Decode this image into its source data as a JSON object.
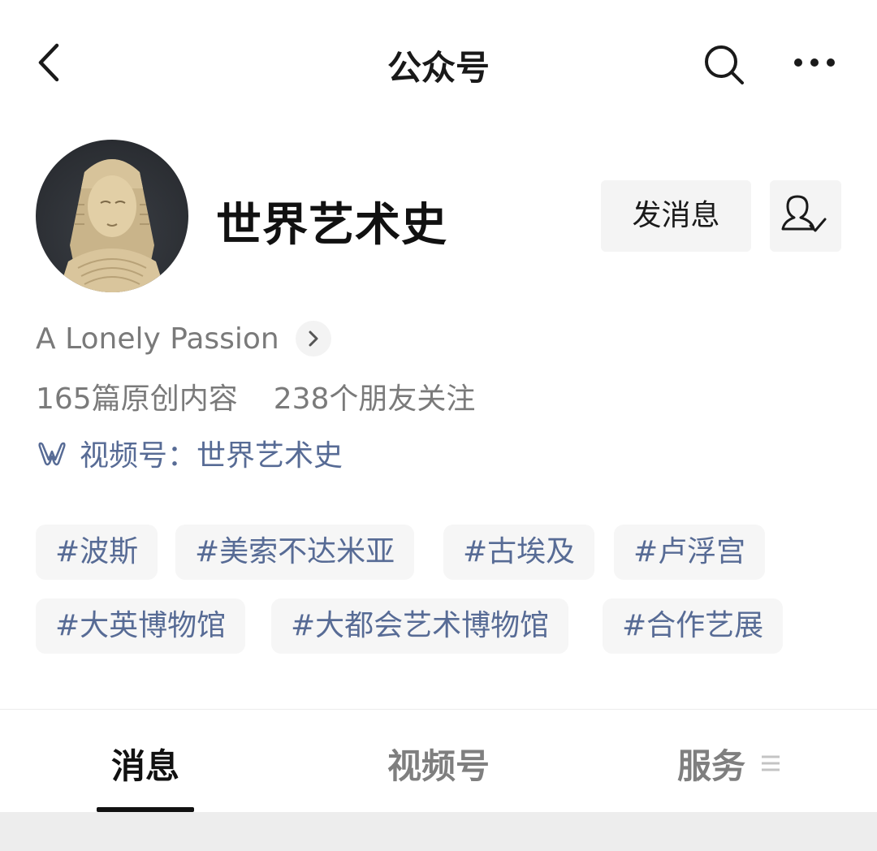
{
  "header": {
    "title": "公众号",
    "back_icon": "chevron-left-icon",
    "search_icon": "search-icon",
    "more_icon": "more-horizontal-icon"
  },
  "profile": {
    "name": "世界艺术史",
    "message_button": "发消息",
    "follow_icon": "user-check-icon",
    "intro": "A Lonely Passion",
    "stats": {
      "articles": "165篇原创内容",
      "friends": "238个朋友关注"
    },
    "channel": {
      "icon": "video-channel-icon",
      "text": "视频号：世界艺术史"
    }
  },
  "tags": [
    "#波斯",
    "#美索不达米亚",
    "#古埃及",
    "#卢浮宫",
    "#大英博物馆",
    "#大都会艺术博物馆",
    "#合作艺展"
  ],
  "tabs": [
    {
      "label": "消息",
      "active": true
    },
    {
      "label": "视频号",
      "active": false
    },
    {
      "label": "服务",
      "active": false,
      "icon": "menu-icon"
    }
  ],
  "colors": {
    "link": "#576b95",
    "gray_text": "#7a7a7a",
    "button_bg": "#f4f4f4"
  }
}
